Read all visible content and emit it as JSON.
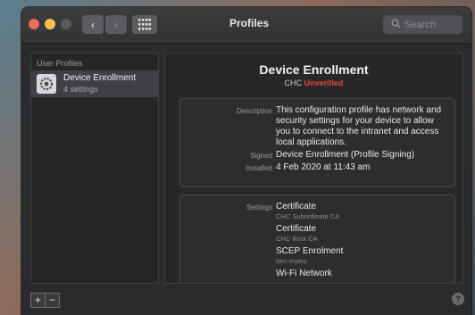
{
  "window": {
    "title": "Profiles"
  },
  "search": {
    "placeholder": "Search"
  },
  "sidebar": {
    "header": "User Profiles",
    "items": [
      {
        "name": "Device Enrollment",
        "subtitle": "4 settings"
      }
    ]
  },
  "profile": {
    "title": "Device Enrollment",
    "organization": "CHC",
    "status": "Unverified",
    "status_color": "#e5483c",
    "labels": {
      "description": "Description",
      "signed": "Signed",
      "installed": "Installed",
      "settings": "Settings"
    },
    "description": "This configuration profile has network and security settings for your device to allow you to connect to the intranet and access local applications.",
    "signed": "Device Enrollment (Profile Signing)",
    "installed": "4 Feb 2020 at 11:43 am",
    "settings": [
      {
        "name": "Certificate",
        "detail": "CHC Subordinate CA"
      },
      {
        "name": "Certificate",
        "detail": "CHC Root CA"
      },
      {
        "name": "SCEP Enrolment",
        "detail": "ben.myers"
      },
      {
        "name": "Wi-Fi Network",
        "detail": ""
      }
    ]
  },
  "footer": {
    "add_label": "+",
    "remove_label": "−",
    "help_label": "?"
  }
}
